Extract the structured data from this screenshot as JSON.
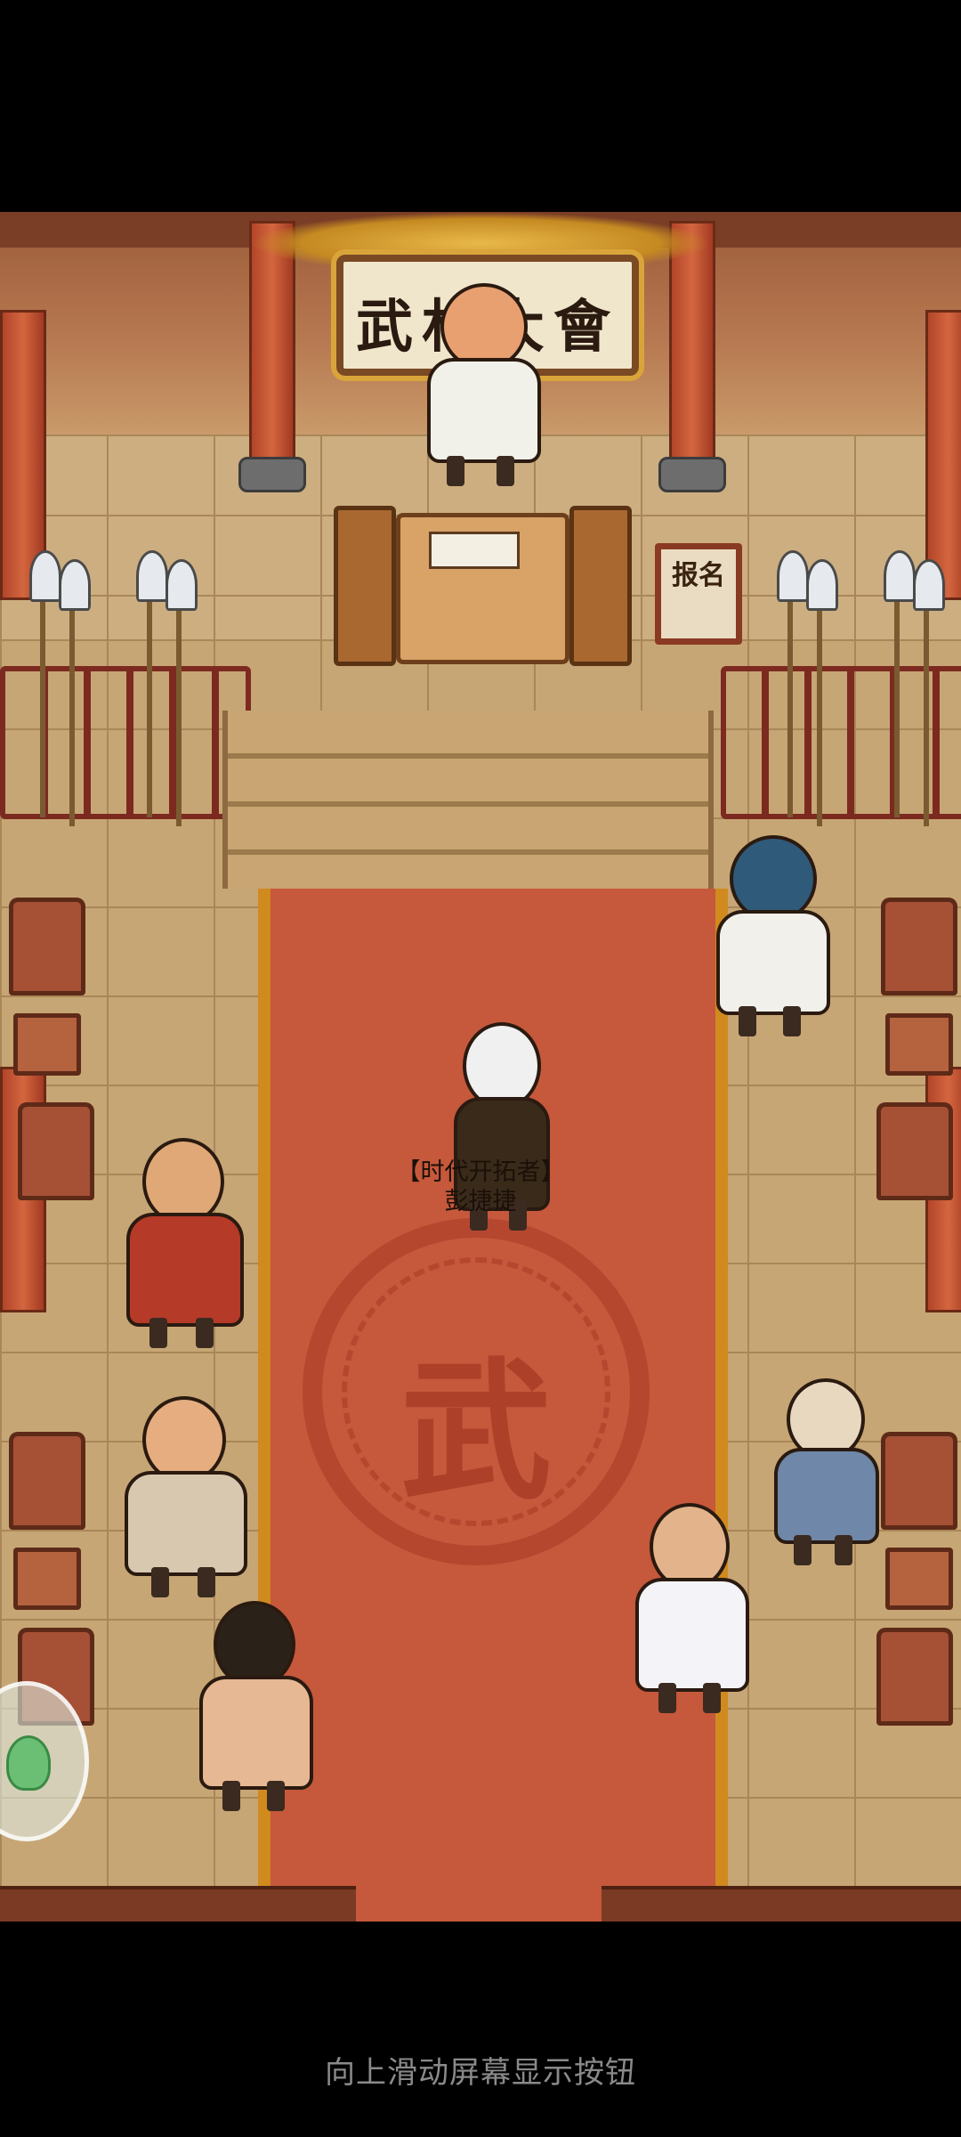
{
  "sign": {
    "text": "武林大會"
  },
  "registration": {
    "text": "报名"
  },
  "emblem": {
    "char": "武"
  },
  "player": {
    "title": "【时代开拓者】",
    "name": "彭捷捷"
  },
  "hint": {
    "text": "向上滑动屏幕显示按钮"
  },
  "characters": [
    {
      "name": "announcer"
    },
    {
      "name": "player-character"
    },
    {
      "name": "blue-haired-brute"
    },
    {
      "name": "prayer-bead-monk"
    },
    {
      "name": "topknot-fighter"
    },
    {
      "name": "long-haired-swordsman"
    },
    {
      "name": "white-robed-swordsman"
    },
    {
      "name": "old-sweeper-monk"
    }
  ],
  "colors": {
    "carpet": "#c6583b",
    "carpet_border": "#d08a1e",
    "floor": "#c7a675",
    "background": "#000000",
    "hint": "#8a8a8a"
  }
}
